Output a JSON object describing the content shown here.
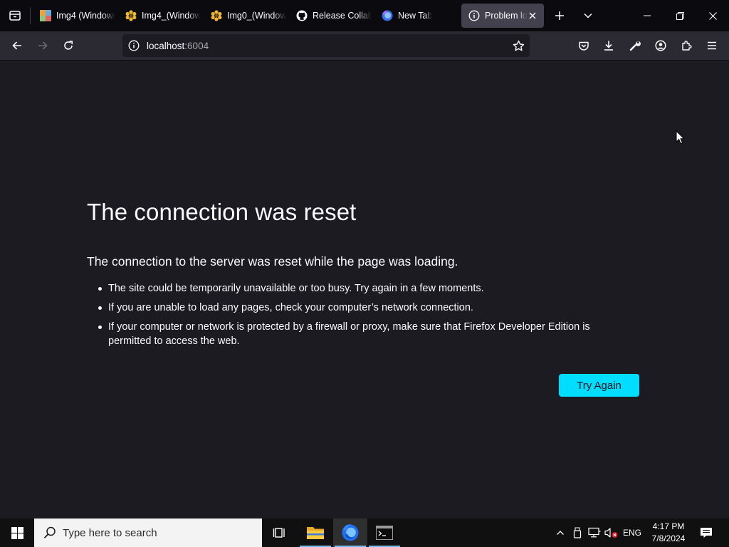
{
  "browser": {
    "tabs": [
      {
        "title": "Img4 (Windows",
        "icon": "image-thumbnail-icon"
      },
      {
        "title": "Img4_(Windows",
        "icon": "flower-favicon-icon"
      },
      {
        "title": "Img0_(Windows",
        "icon": "flower-favicon-icon"
      },
      {
        "title": "Release Collab",
        "icon": "github-icon"
      },
      {
        "title": "New Tab",
        "icon": "firefox-icon"
      },
      {
        "title": "Problem lo",
        "icon": "info-icon",
        "active": true
      }
    ],
    "url": {
      "host": "localhost",
      "port": ":6004"
    }
  },
  "error_page": {
    "title": "The connection was reset",
    "description": "The connection to the server was reset while the page was loading.",
    "bullets": [
      "The site could be temporarily unavailable or too busy. Try again in a few moments.",
      "If you are unable to load any pages, check your computer’s network connection.",
      "If your computer or network is protected by a firewall or proxy, make sure that Firefox Developer Edition is permitted to access the web."
    ],
    "button_label": "Try Again",
    "accent_color": "#00ddff"
  },
  "taskbar": {
    "search_placeholder": "Type here to search",
    "language": "ENG",
    "time": "4:17 PM",
    "date": "7/8/2024"
  },
  "colors": {
    "page_bg": "#1c1b22",
    "toolbar_bg": "#2b2a33",
    "tabstrip_bg": "#0b0b0f",
    "text": "#fbfbfe",
    "taskbar_accent": "#76b9ed"
  }
}
